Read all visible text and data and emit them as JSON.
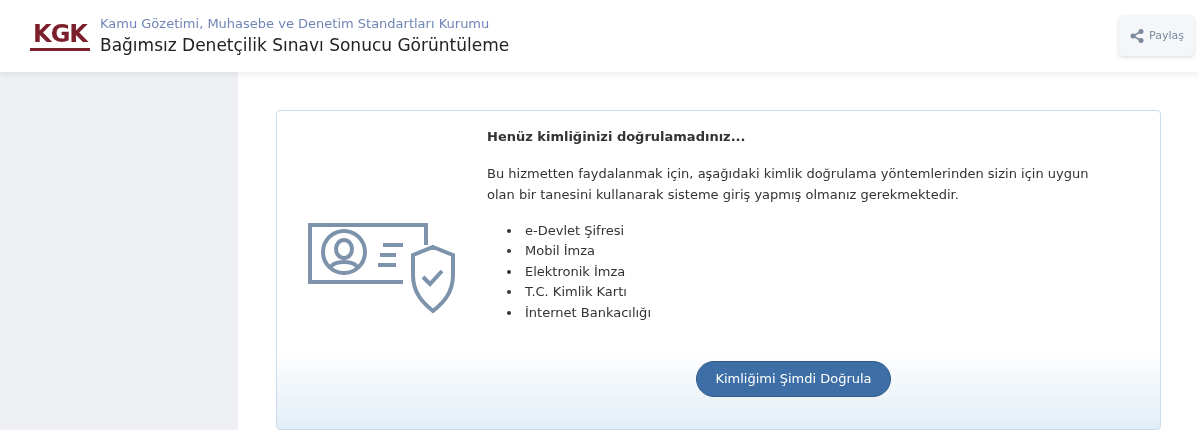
{
  "header": {
    "logo": "KGK",
    "organization": "Kamu Gözetimi, Muhasebe ve Denetim Standartları Kurumu",
    "title": "Bağımsız Denetçilik Sınavı Sonucu Görüntüleme",
    "share_button": "Paylaş"
  },
  "notice": {
    "heading": "Henüz kimliğinizi doğrulamadınız...",
    "message": "Bu hizmetten faydalanmak için, aşağıdaki kimlik doğrulama yöntemlerinden sizin için uygun olan bir tanesini kullanarak sisteme giriş yapmış olmanız gerekmektedir.",
    "methods": [
      "e-Devlet Şifresi",
      "Mobil İmza",
      "Elektronik İmza",
      "T.C. Kimlik Kartı",
      "İnternet Bankacılığı"
    ],
    "verify_button": "Kimliğimi Şimdi Doğrula"
  }
}
